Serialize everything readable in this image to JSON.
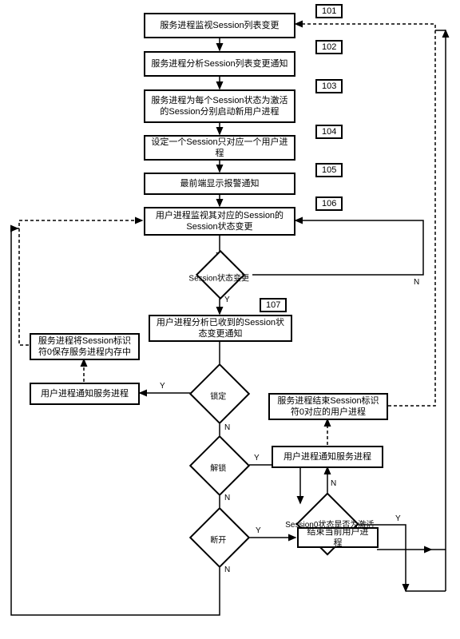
{
  "chart_data": {
    "type": "flowchart",
    "title": "",
    "nodes": [
      {
        "id": "101",
        "label": "101",
        "text": "服务进程监视Session列表变更"
      },
      {
        "id": "102",
        "label": "102",
        "text": "服务进程分析Session列表变更通知"
      },
      {
        "id": "103",
        "label": "103",
        "text": "服务进程为每个Session状态为激活的Session分别启动新用户进程"
      },
      {
        "id": "104",
        "label": "104",
        "text": "设定一个Session只对应一个用户进程"
      },
      {
        "id": "105",
        "label": "105",
        "text": "最前端显示报警通知"
      },
      {
        "id": "106",
        "label": "106",
        "text": "用户进程监视其对应的Session的Session状态变更"
      },
      {
        "id": "107",
        "label": "107",
        "text": "用户进程分析已收到的Session状态变更通知"
      },
      {
        "id": "d_change",
        "text": "Session状态变更"
      },
      {
        "id": "d_lock",
        "text": "锁定"
      },
      {
        "id": "d_unlock",
        "text": "解锁"
      },
      {
        "id": "d_disconnect",
        "text": "断开"
      },
      {
        "id": "d_active",
        "text": "Session0状态是否为激活"
      },
      {
        "id": "left_notify",
        "text": "用户进程通知服务进程"
      },
      {
        "id": "left_save",
        "text": "服务进程将Session标识符0保存服务进程内存中"
      },
      {
        "id": "right_notify",
        "text": "用户进程通知服务进程"
      },
      {
        "id": "right_end",
        "text": "服务进程结束Session标识符0对应的用户进程"
      },
      {
        "id": "end_current",
        "text": "结束当前用户进程"
      }
    ],
    "edges": [
      {
        "from": "101",
        "to": "102"
      },
      {
        "from": "102",
        "to": "103"
      },
      {
        "from": "103",
        "to": "104"
      },
      {
        "from": "104",
        "to": "105"
      },
      {
        "from": "105",
        "to": "106"
      },
      {
        "from": "106",
        "to": "d_change"
      },
      {
        "from": "d_change",
        "to": "107",
        "label": "Y"
      },
      {
        "from": "d_change",
        "to": "106",
        "label": "N"
      },
      {
        "from": "107",
        "to": "d_lock"
      },
      {
        "from": "d_lock",
        "to": "left_notify",
        "label": "Y"
      },
      {
        "from": "d_lock",
        "to": "d_unlock",
        "label": "N"
      },
      {
        "from": "left_notify",
        "to": "left_save",
        "style": "dashed"
      },
      {
        "from": "left_save",
        "to": "106",
        "style": "dashed"
      },
      {
        "from": "d_unlock",
        "to": "d_disconnect",
        "label": "N"
      },
      {
        "from": "d_unlock",
        "to": "d_active",
        "label": "Y"
      },
      {
        "from": "d_active",
        "to": "right_notify",
        "label": "N"
      },
      {
        "from": "d_active",
        "to": "101",
        "label": "Y"
      },
      {
        "from": "right_notify",
        "to": "right_end",
        "style": "dashed"
      },
      {
        "from": "right_end",
        "to": "101",
        "style": "dashed"
      },
      {
        "from": "d_disconnect",
        "to": "end_current",
        "label": "Y"
      },
      {
        "from": "d_disconnect",
        "to": "106",
        "label": "N"
      },
      {
        "from": "end_current",
        "to": "101"
      }
    ],
    "yes_label": "Y",
    "no_label": "N"
  }
}
